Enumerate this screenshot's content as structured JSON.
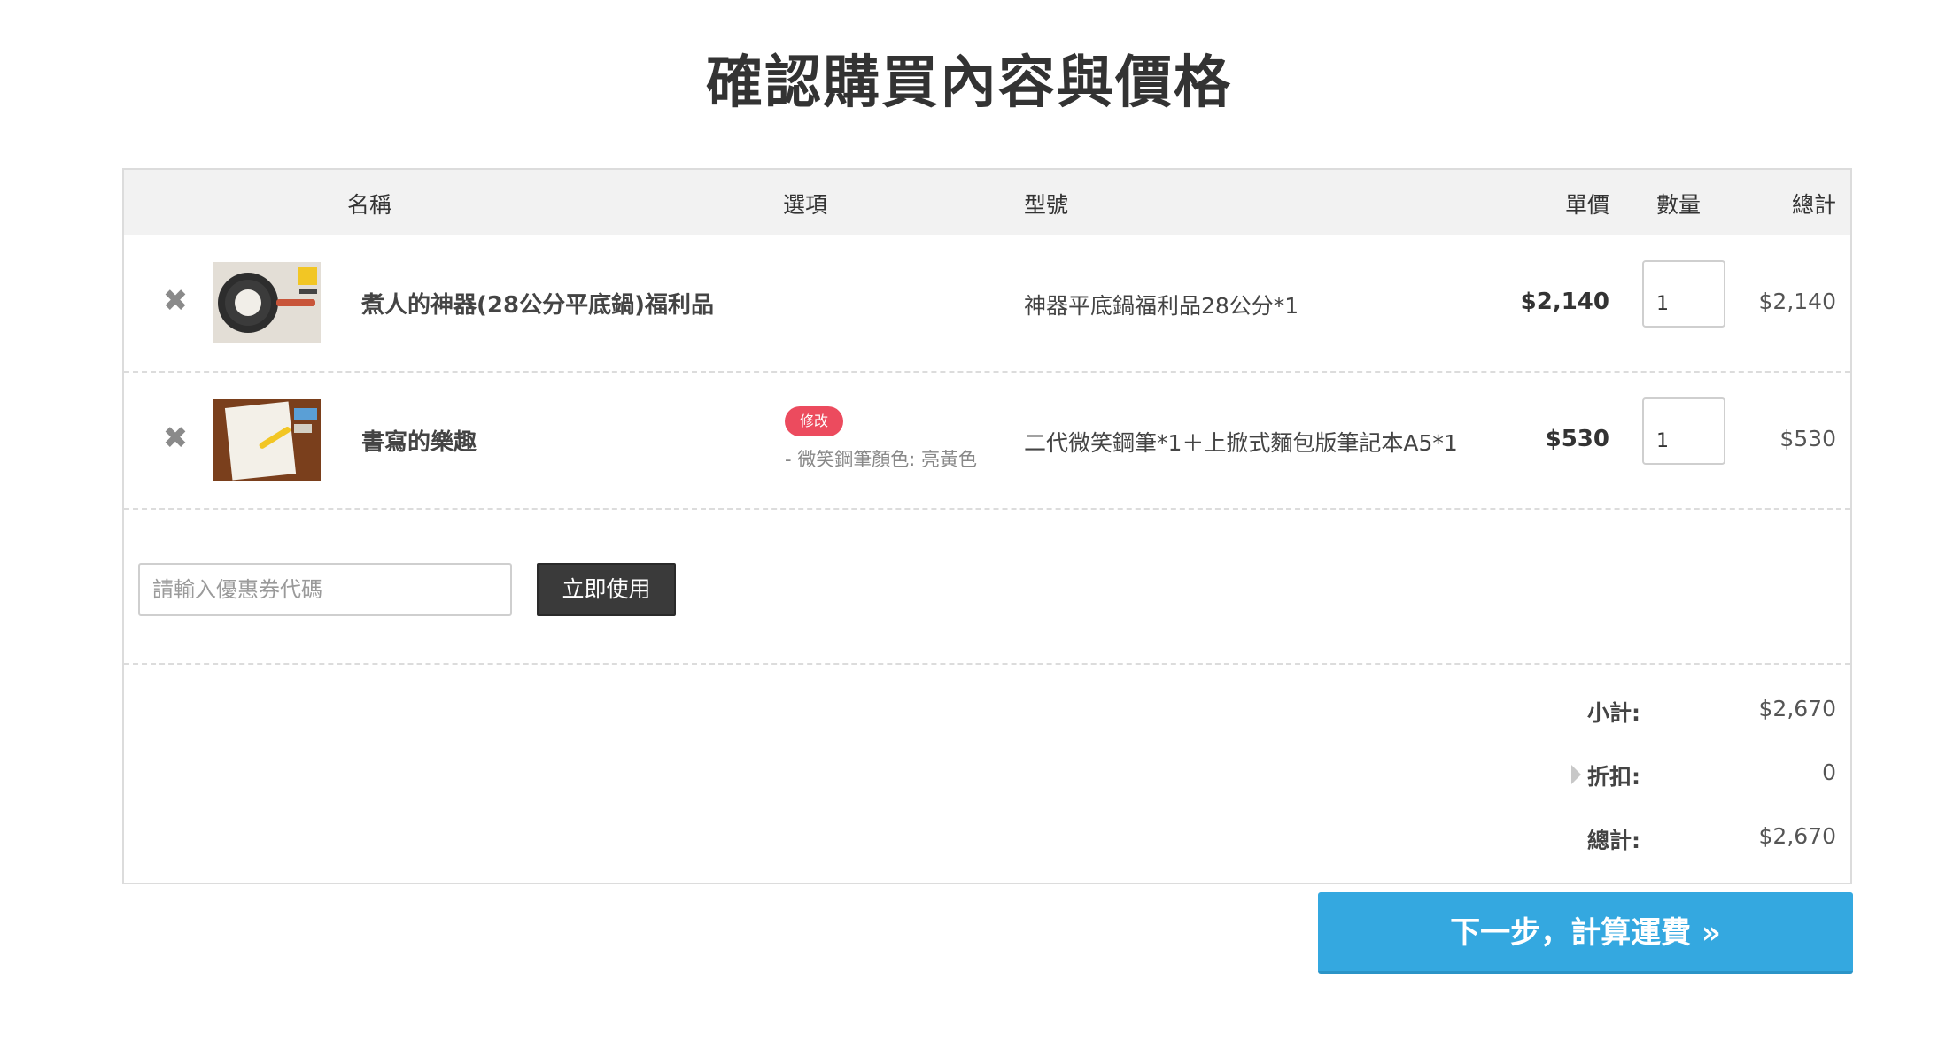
{
  "page": {
    "title": "確認購買內容與價格"
  },
  "table": {
    "headers": {
      "name": "名稱",
      "options": "選項",
      "model": "型號",
      "unit_price": "單價",
      "quantity": "數量",
      "total": "總計"
    }
  },
  "items": [
    {
      "name": "煮人的神器(28公分平底鍋)福利品",
      "model": "神器平底鍋福利品28公分*1",
      "unit_price": "$2,140",
      "quantity": "1",
      "line_total": "$2,140",
      "remove_icon": "close-icon"
    },
    {
      "name": "書寫的樂趣",
      "edit_label": "修改",
      "option": "- 微笑鋼筆顏色: 亮黃色",
      "model": "二代微笑鋼筆*1＋上掀式麵包版筆記本A5*1",
      "unit_price": "$530",
      "quantity": "1",
      "line_total": "$530",
      "remove_icon": "close-icon"
    }
  ],
  "coupon": {
    "placeholder": "請輸入優惠券代碼",
    "button_label": "立即使用"
  },
  "summary": {
    "subtotal_label": "小計:",
    "subtotal_value": "$2,670",
    "discount_label": "折扣:",
    "discount_value": "0",
    "total_label": "總計:",
    "total_value": "$2,670"
  },
  "next_button": {
    "label": "下一步，計算運費 »"
  },
  "colors": {
    "accent_blue": "#34a8e0",
    "badge_red": "#ec4b5e",
    "dark_button": "#3a3a3a",
    "header_bg": "#f2f2f2"
  }
}
